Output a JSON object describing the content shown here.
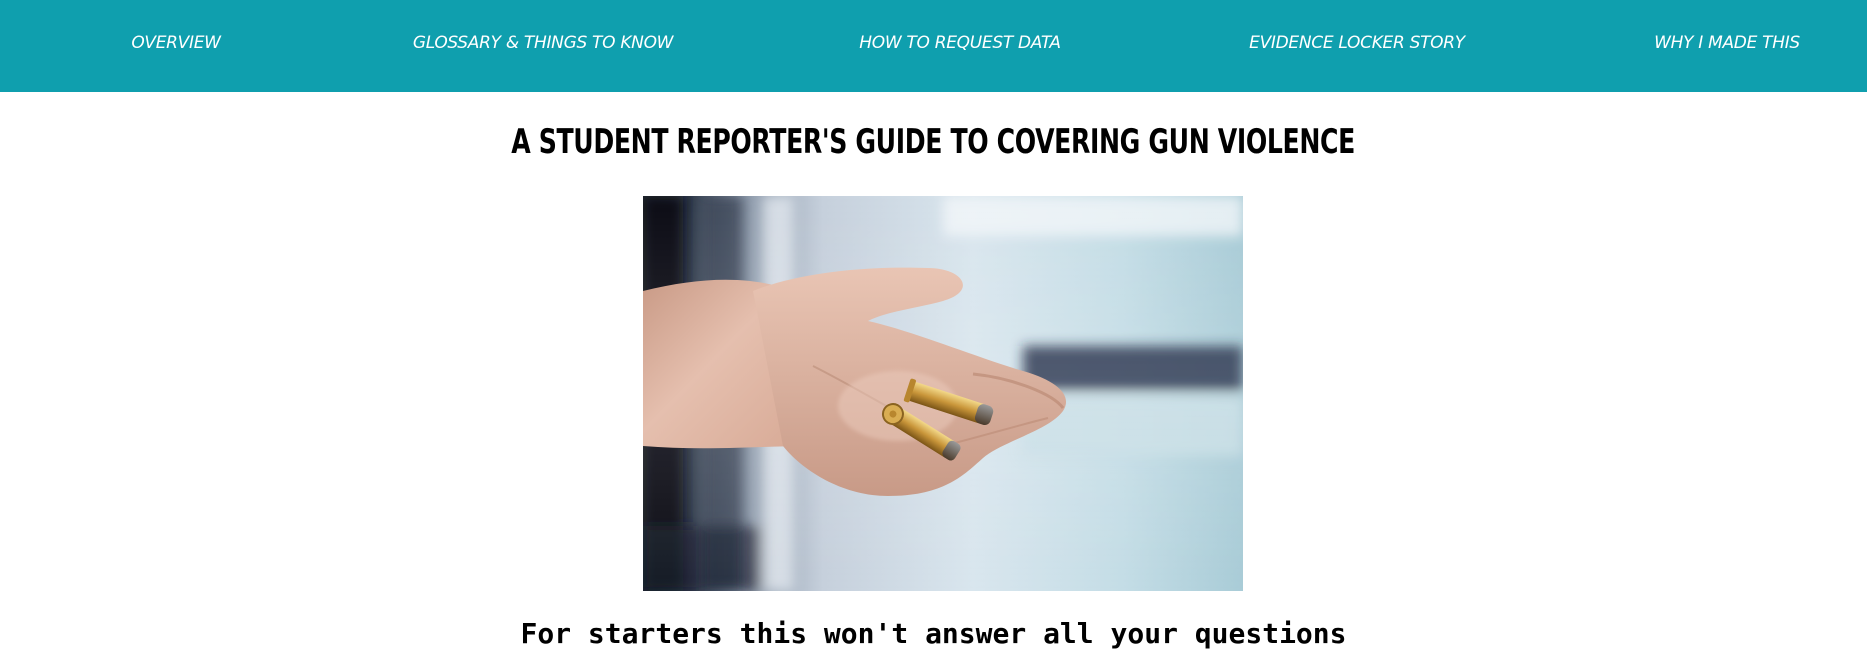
{
  "nav": {
    "items": [
      {
        "label": "OVERVIEW"
      },
      {
        "label": "GLOSSARY & THINGS TO KNOW"
      },
      {
        "label": "HOW TO REQUEST DATA"
      },
      {
        "label": "EVIDENCE LOCKER STORY"
      },
      {
        "label": "WHY I MADE THIS"
      }
    ]
  },
  "main": {
    "title": "A STUDENT REPORTER'S GUIDE TO COVERING GUN VIOLENCE",
    "subheading": "For starters this won't answer all your questions"
  },
  "colors": {
    "nav_background": "#0f9fae",
    "nav_text": "#ffffff",
    "title_text": "#000000"
  }
}
